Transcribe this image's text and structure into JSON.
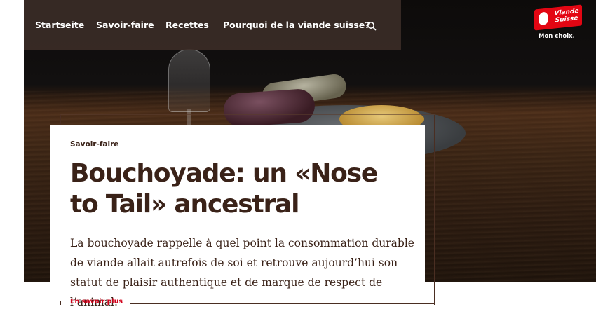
{
  "nav": {
    "items": [
      {
        "label": "Startseite"
      },
      {
        "label": "Savoir-faire"
      },
      {
        "label": "Recettes"
      },
      {
        "label": "Pourquoi de la viande suisse?"
      }
    ],
    "search_icon": "search-icon"
  },
  "logo": {
    "line1": "Viande",
    "line2": "Suisse",
    "tagline": "Mon choix."
  },
  "article": {
    "category": "Savoir-faire",
    "title_line1": "Bouchoyade: un «Nose",
    "title_line2": "to Tail» ancestral",
    "lead": "La bouchoyade rappelle à quel point la consommation durable de viande allait autrefois de soi et retrouve aujourd’hui son statut de plaisir authentique et de marque de respect de l’animal.",
    "more_label": "En savoir plus"
  },
  "colors": {
    "nav_bg": "#3c2d28",
    "brand_red": "#e30613",
    "text_brown": "#3a2218",
    "link_red": "#d0021b"
  }
}
